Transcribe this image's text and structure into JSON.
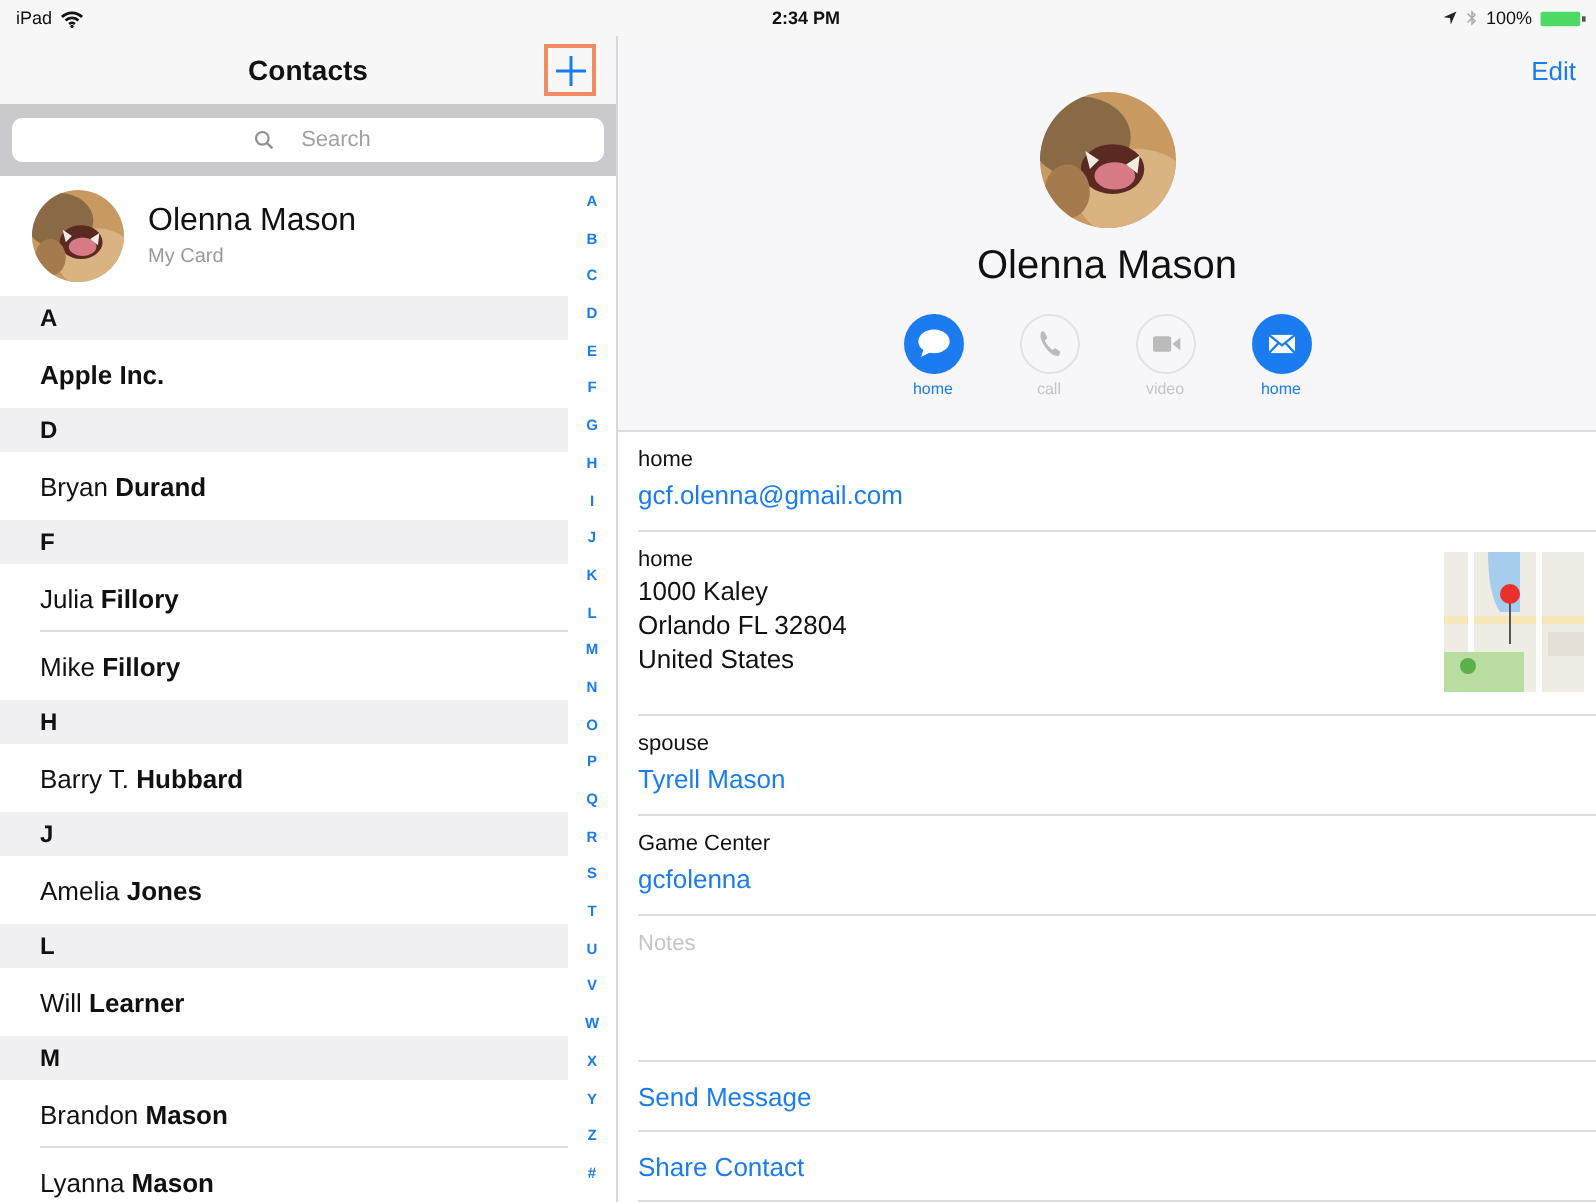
{
  "status_bar": {
    "device": "iPad",
    "time": "2:34 PM",
    "battery": "100%"
  },
  "contacts": {
    "title": "Contacts",
    "search": {
      "placeholder": "Search"
    },
    "my_card": {
      "name": "Olenna Mason",
      "subtitle": "My Card"
    },
    "sections": [
      {
        "letter": "A",
        "rows": [
          {
            "name": "Apple Inc.",
            "kind": "company"
          }
        ]
      },
      {
        "letter": "D",
        "rows": [
          {
            "name": "Bryan **Durand**",
            "kind": "person"
          }
        ]
      },
      {
        "letter": "F",
        "rows": [
          {
            "name": "Julia **Fillory**",
            "kind": "person"
          },
          {
            "name": "Mike **Fillory**",
            "kind": "person"
          }
        ]
      },
      {
        "letter": "H",
        "rows": [
          {
            "name": "Barry T. **Hubbard**",
            "kind": "person"
          }
        ]
      },
      {
        "letter": "J",
        "rows": [
          {
            "name": "Amelia **Jones**",
            "kind": "person"
          }
        ]
      },
      {
        "letter": "L",
        "rows": [
          {
            "name": "Will **Learner**",
            "kind": "person"
          }
        ]
      },
      {
        "letter": "M",
        "rows": [
          {
            "name": "Brandon **Mason**",
            "kind": "person"
          },
          {
            "name": "Lyanna **Mason**",
            "kind": "person"
          }
        ]
      }
    ],
    "index": [
      "A",
      "B",
      "C",
      "D",
      "E",
      "F",
      "G",
      "H",
      "I",
      "J",
      "K",
      "L",
      "M",
      "N",
      "O",
      "P",
      "Q",
      "R",
      "S",
      "T",
      "U",
      "V",
      "W",
      "X",
      "Y",
      "Z",
      "#"
    ]
  },
  "detail": {
    "edit": "Edit",
    "name": "Olenna Mason",
    "actions": [
      {
        "kind": "message",
        "label": "home",
        "enabled": true
      },
      {
        "kind": "call",
        "label": "call",
        "enabled": false
      },
      {
        "kind": "video",
        "label": "video",
        "enabled": false
      },
      {
        "kind": "mail",
        "label": "home",
        "enabled": true
      }
    ],
    "fields": [
      {
        "kind": "link",
        "label": "home",
        "value": "gcf.olenna@gmail.com"
      },
      {
        "kind": "address",
        "label": "home",
        "lines": [
          "1000 Kaley",
          "Orlando FL 32804",
          "United States"
        ]
      },
      {
        "kind": "link",
        "label": "spouse",
        "value": "Tyrell Mason"
      },
      {
        "kind": "link",
        "label": "Game Center",
        "value": "gcfolenna"
      },
      {
        "kind": "notes",
        "placeholder": "Notes"
      }
    ],
    "commands": [
      "Send Message",
      "Share Contact"
    ]
  }
}
